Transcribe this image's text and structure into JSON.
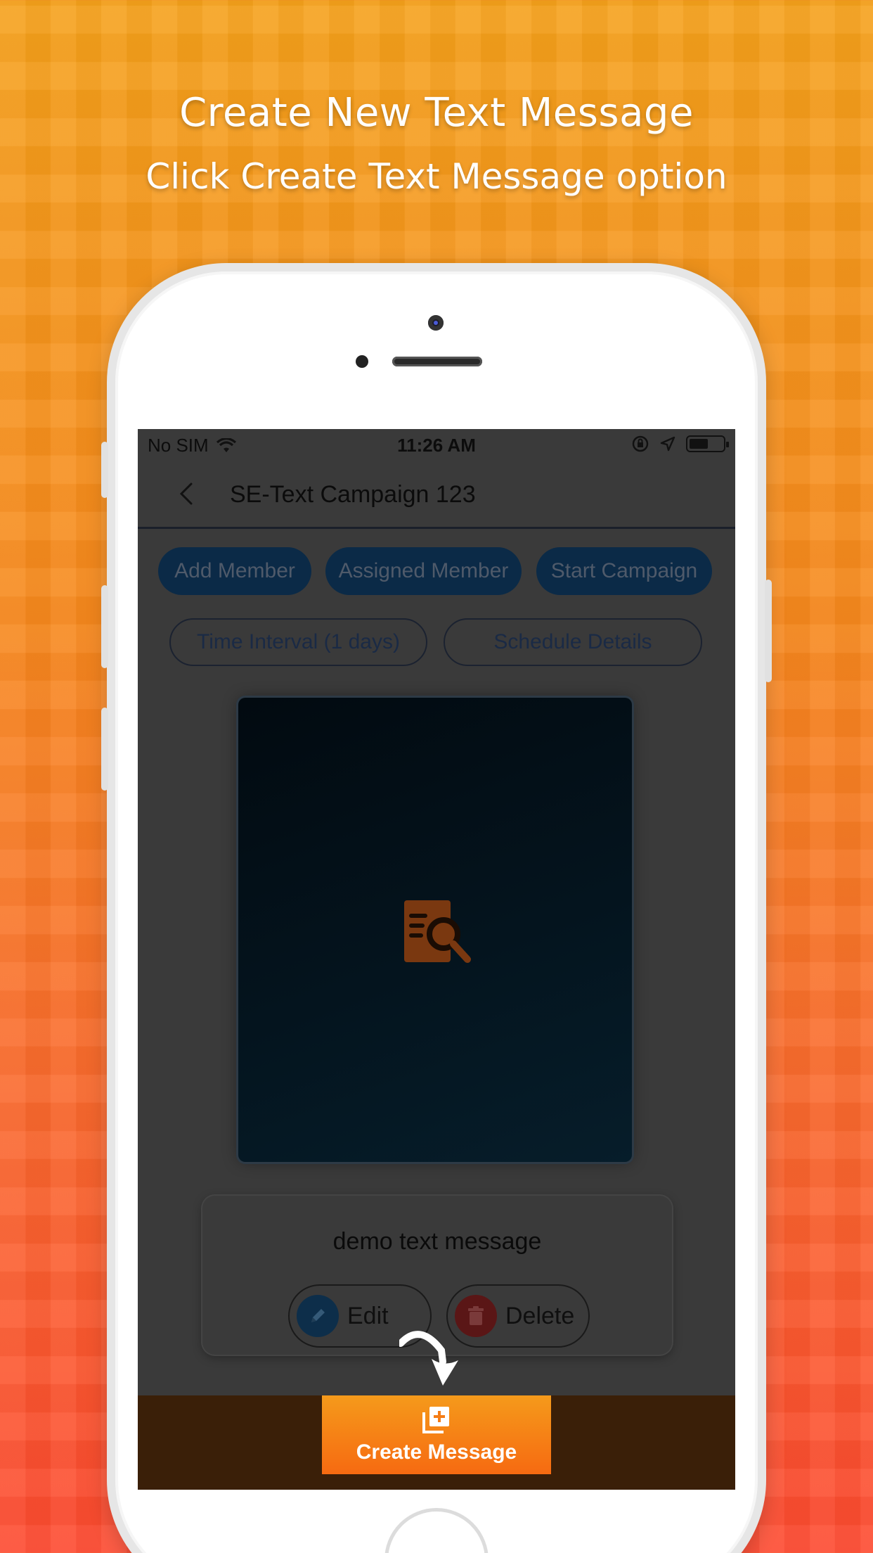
{
  "header": {
    "title": "Create New Text Message",
    "subtitle": "Click Create Text Message option"
  },
  "status_bar": {
    "carrier": "No SIM",
    "time": "11:26 AM",
    "icons": [
      "wifi-icon",
      "orientation-lock-icon",
      "location-icon",
      "battery-icon"
    ]
  },
  "nav": {
    "title": "SE-Text Campaign 123",
    "back_icon": "chevron-left-icon"
  },
  "actions": {
    "add_member": "Add Member",
    "assigned_member": "Assigned Member",
    "start_campaign": "Start Campaign",
    "time_interval": "Time Interval (1 days)",
    "schedule_details": "Schedule Details"
  },
  "preview": {
    "icon": "document-search-icon",
    "accent_color": "#f26a1b"
  },
  "message_card": {
    "text": "demo text message",
    "edit_label": "Edit",
    "delete_label": "Delete",
    "edit_icon": "pencil-icon",
    "delete_icon": "trash-icon"
  },
  "bottom": {
    "create_label": "Create Message",
    "create_icon": "add-copy-icon"
  },
  "colors": {
    "background_top": "#f6a11c",
    "background_bottom": "#fd4a30",
    "screen_overlay": "#3a3a3a",
    "primary_button": "#0b2a47"
  }
}
